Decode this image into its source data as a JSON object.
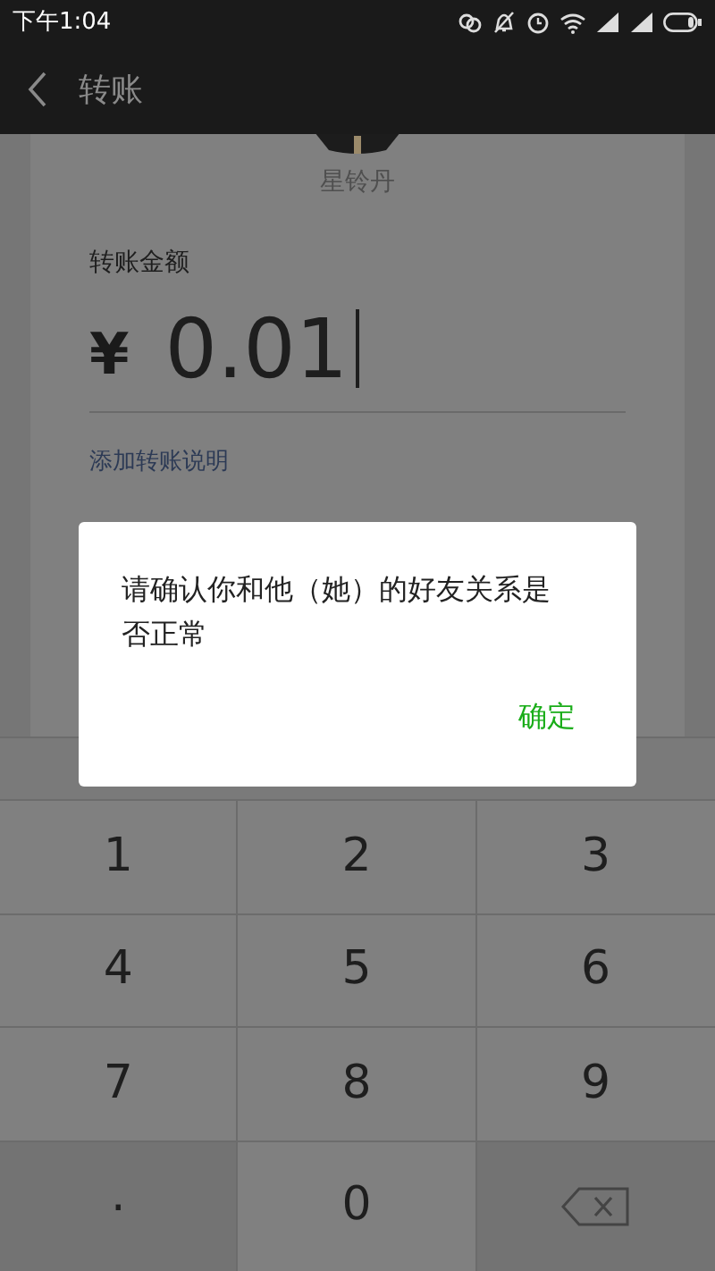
{
  "status_bar": {
    "time": "下午1:04"
  },
  "header": {
    "title": "转账"
  },
  "payee": {
    "name": "星铃丹"
  },
  "amount": {
    "label": "转账金额",
    "currency": "¥",
    "value": "0.01"
  },
  "note_link": "添加转账说明",
  "dialog": {
    "message": "请确认你和他（她）的好友关系是否正常",
    "button": "确定"
  },
  "keypad": [
    {
      "kind": "digit",
      "label": "1"
    },
    {
      "kind": "digit",
      "label": "2"
    },
    {
      "kind": "digit",
      "label": "3"
    },
    {
      "kind": "digit",
      "label": "4"
    },
    {
      "kind": "digit",
      "label": "5"
    },
    {
      "kind": "digit",
      "label": "6"
    },
    {
      "kind": "digit",
      "label": "7"
    },
    {
      "kind": "digit",
      "label": "8"
    },
    {
      "kind": "digit",
      "label": "9"
    },
    {
      "kind": "dot",
      "label": "."
    },
    {
      "kind": "digit",
      "label": "0"
    },
    {
      "kind": "backspace"
    }
  ]
}
